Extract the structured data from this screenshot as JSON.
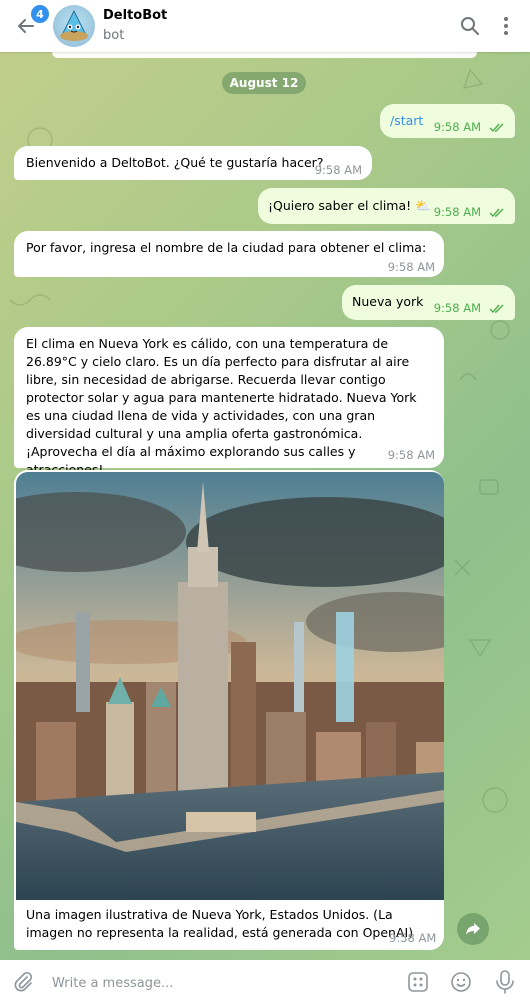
{
  "header": {
    "unread_count": "4",
    "title": "DeltoBot",
    "subtitle": "bot"
  },
  "date_label": "August 12",
  "messages": [
    {
      "text": "/start",
      "time": "9:58 AM"
    },
    {
      "text": "Bienvenido a DeltoBot. ¿Qué te gustaría hacer?",
      "time": "9:58 AM"
    },
    {
      "text": "¡Quiero saber el clima! ⛅",
      "time": "9:58 AM"
    },
    {
      "text": "Por favor, ingresa el nombre de la ciudad para obtener el clima:",
      "time": "9:58 AM"
    },
    {
      "text": "Nueva york",
      "time": "9:58 AM"
    },
    {
      "text": "El clima en Nueva York es cálido, con una temperatura de 26.89°C y cielo claro. Es un día perfecto para disfrutar al aire libre, sin necesidad de abrigarse. Recuerda llevar contigo protector solar y agua para mantenerte hidratado. Nueva York es una ciudad llena de vida y actividades, con una gran diversidad cultural y una amplia oferta gastronómica. ¡Aprovecha el día al máximo explorando sus calles y atracciones!",
      "time": "9:58 AM"
    },
    {
      "text": "Una imagen ilustrativa de Nueva York, Estados Unidos. (La imagen no representa la realidad, está generada con OpenAI)",
      "time": "9:58 AM"
    }
  ],
  "composer": {
    "placeholder": "Write a message..."
  },
  "icons": {
    "back": "arrow-left-icon",
    "search": "search-icon",
    "more": "more-vertical-icon",
    "attach": "paperclip-icon",
    "commands": "bot-commands-icon",
    "emoji": "smile-icon",
    "voice": "microphone-icon",
    "share": "share-arrow-icon"
  },
  "colors": {
    "accent": "#3390ec",
    "outgoing_bubble": "#effdde",
    "read_ticks": "#4fae4e",
    "chat_background": "#a9c98a"
  }
}
